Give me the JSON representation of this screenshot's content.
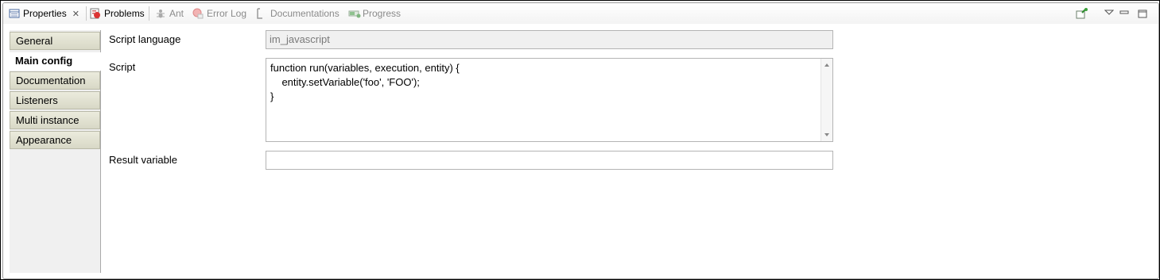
{
  "tabs": [
    {
      "label": "Properties",
      "icon": "properties-icon",
      "active": true
    },
    {
      "label": "Problems",
      "icon": "problems-icon"
    },
    {
      "label": "Ant",
      "icon": "ant-icon"
    },
    {
      "label": "Error Log",
      "icon": "error-log-icon"
    },
    {
      "label": "Documentations",
      "icon": "documentations-icon"
    },
    {
      "label": "Progress",
      "icon": "progress-icon"
    }
  ],
  "sidebar": {
    "items": [
      {
        "label": "General"
      },
      {
        "label": "Main config",
        "selected": true
      },
      {
        "label": "Documentation"
      },
      {
        "label": "Listeners"
      },
      {
        "label": "Multi instance"
      },
      {
        "label": "Appearance"
      }
    ]
  },
  "form": {
    "script_language_label": "Script language",
    "script_language_value": "im_javascript",
    "script_label": "Script",
    "script_value": "function run(variables, execution, entity) {\n    entity.setVariable('foo', 'FOO');\n}",
    "result_variable_label": "Result variable",
    "result_variable_value": ""
  },
  "colors": {
    "sidebar_tab": "#dcdccb",
    "frame_border": "#000000"
  }
}
